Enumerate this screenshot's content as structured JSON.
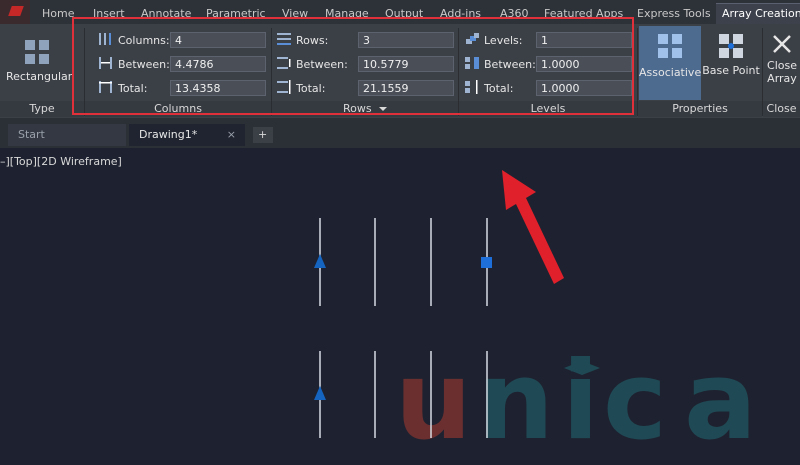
{
  "ribbon_tabs": [
    "Home",
    "Insert",
    "Annotate",
    "Parametric",
    "View",
    "Manage",
    "Output",
    "Add-ins",
    "A360",
    "Featured Apps",
    "Express Tools",
    "Array Creation"
  ],
  "type_panel": {
    "button": "Rectangular",
    "title": "Type"
  },
  "columns_panel": {
    "title": "Columns",
    "count_label": "Columns:",
    "count_value": "4",
    "between_label": "Between:",
    "between_value": "4.4786",
    "total_label": "Total:",
    "total_value": "13.4358"
  },
  "rows_panel": {
    "title": "Rows",
    "count_label": "Rows:",
    "count_value": "3",
    "between_label": "Between:",
    "between_value": "10.5779",
    "total_label": "Total:",
    "total_value": "21.1559"
  },
  "levels_panel": {
    "title": "Levels",
    "count_label": "Levels:",
    "count_value": "1",
    "between_label": "Between:",
    "between_value": "1.0000",
    "total_label": "Total:",
    "total_value": "1.0000"
  },
  "properties_panel": {
    "associative": "Associative",
    "base_point": "Base Point",
    "title": "Properties"
  },
  "close_panel": {
    "line1": "Close",
    "line2": "Array",
    "title": "Close"
  },
  "doc_tabs": {
    "start": "Start",
    "drawing": "Drawing1*",
    "new_tab": "+",
    "close": "×"
  },
  "viewport": {
    "label": "–][Top][2D Wireframe]"
  },
  "watermark": {
    "letters": [
      "u",
      "n",
      "i",
      "c",
      "a"
    ]
  },
  "colors": {
    "highlight": "#e0303a",
    "accent_blue": "#1565c0",
    "grip_blue": "#1e6fd9"
  }
}
